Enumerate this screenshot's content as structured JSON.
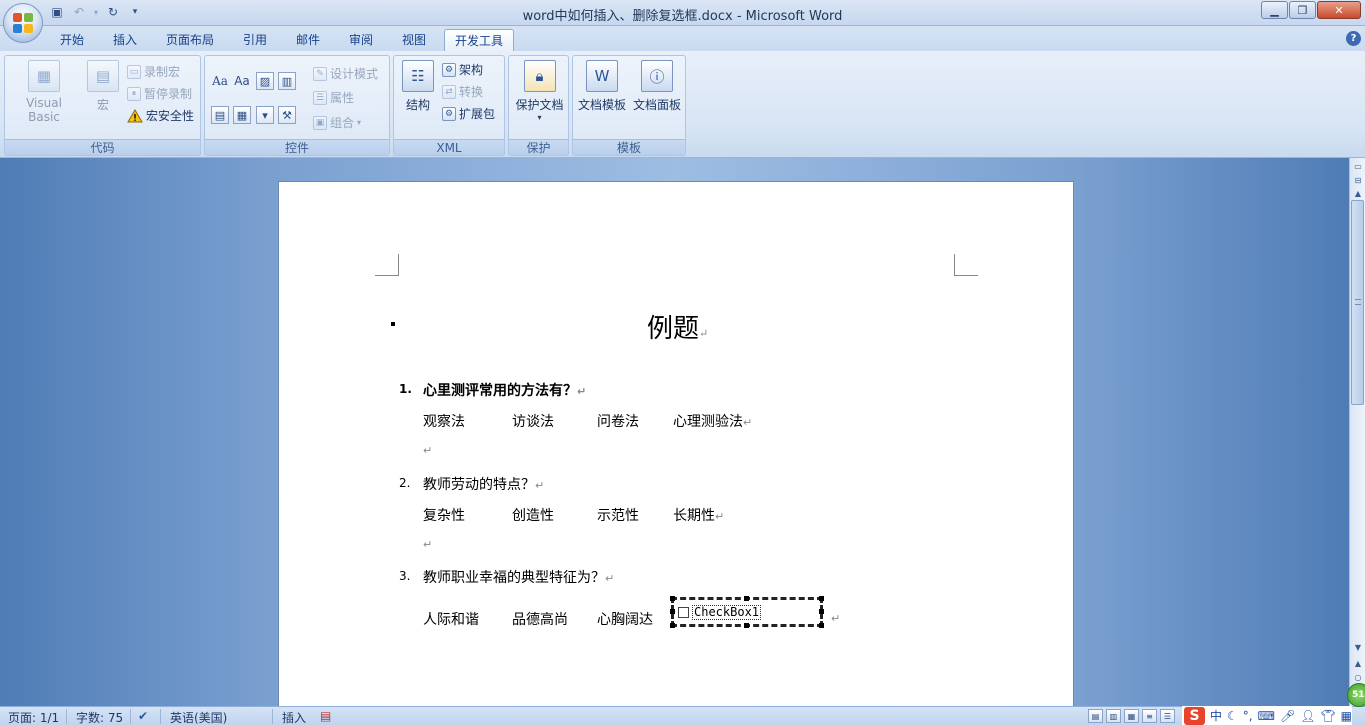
{
  "window": {
    "title": "word中如何插入、删除复选框.docx - Microsoft Word",
    "controls": [
      "minimize",
      "restore",
      "close"
    ]
  },
  "quick_access": [
    {
      "name": "save-icon",
      "glyph": "▣"
    },
    {
      "name": "undo-icon",
      "glyph": "↶"
    },
    {
      "name": "redo-icon",
      "glyph": "↻"
    },
    {
      "name": "customize-icon",
      "glyph": "⏷"
    }
  ],
  "tabs": [
    "开始",
    "插入",
    "页面布局",
    "引用",
    "邮件",
    "审阅",
    "视图",
    "开发工具"
  ],
  "active_tab": "开发工具",
  "ribbon": {
    "code": {
      "label": "代码",
      "visual_basic": "Visual Basic",
      "macros": "宏",
      "record_macro": "录制宏",
      "pause_recording": "暂停录制",
      "macro_security": "宏安全性"
    },
    "controls": {
      "label": "控件",
      "design_mode": "设计模式",
      "properties": "属性",
      "group": "组合"
    },
    "xml": {
      "label": "XML",
      "structure": "结构",
      "schema": "架构",
      "transform": "转换",
      "expansion_pack": "扩展包"
    },
    "protect": {
      "label": "保护",
      "protect_document": "保护文档"
    },
    "templates": {
      "label": "模板",
      "document_template": "文档模板",
      "document_panel": "文档面板"
    }
  },
  "document": {
    "title": "例题",
    "questions": [
      {
        "number": "1.",
        "text": "心里测评常用的方法有？",
        "bold": true,
        "options": [
          "观察法",
          "访谈法",
          "问卷法",
          "心理测验法"
        ]
      },
      {
        "number": "2.",
        "text": "教师劳动的特点？",
        "bold": false,
        "options": [
          "复杂性",
          "创造性",
          "示范性",
          "长期性"
        ]
      },
      {
        "number": "3.",
        "text": "教师职业幸福的典型特征为？",
        "bold": false,
        "options": [
          "人际和谐",
          "品德高尚",
          "心胸阔达"
        ]
      }
    ],
    "checkbox_label": "CheckBox1",
    "para_mark": "↵"
  },
  "statusbar": {
    "page": "页面: 1/1",
    "words": "字数: 75",
    "language": "英语(美国)",
    "mode": "插入"
  },
  "ime": {
    "logo": "S",
    "lang": "中",
    "badge": "51"
  },
  "colors": {
    "ribbon_text": "#15428b",
    "doc_background": "#7aa0d0",
    "statusbar": "#c0d4ee"
  }
}
